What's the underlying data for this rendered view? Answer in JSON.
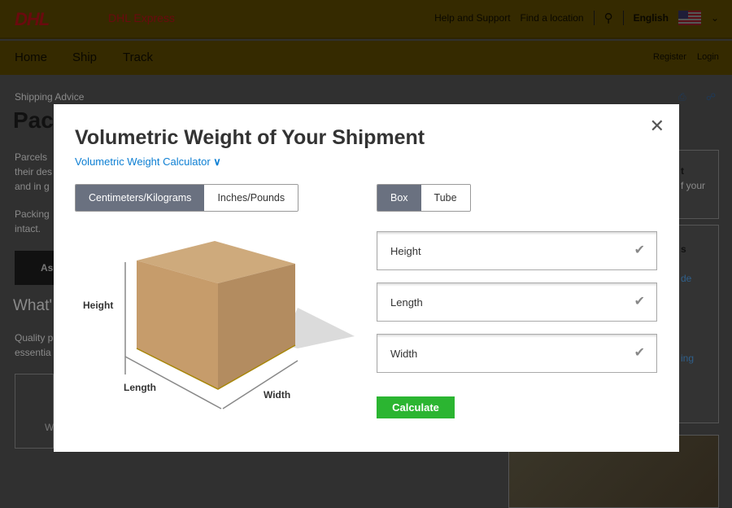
{
  "header": {
    "logo": "DHL",
    "brand": "DHL Express",
    "links": [
      "Help and Support",
      "Find a location"
    ],
    "language": "English"
  },
  "nav": {
    "items": [
      "Home",
      "Ship",
      "Track"
    ],
    "register": "Register",
    "login": "Login"
  },
  "background": {
    "breadcrumb": "Shipping Advice",
    "heading": "Pac",
    "p1": [
      "Parcels",
      "their des",
      "and in g"
    ],
    "p2": [
      "Packing",
      "intact."
    ],
    "button": "As",
    "heading2": "What'",
    "p3": [
      "Quality p",
      "essentia"
    ],
    "card_text": "W",
    "right": [
      "t",
      "f your",
      "s",
      "de",
      "ing"
    ]
  },
  "modal": {
    "title": "Volumetric Weight of Your Shipment",
    "subtitle": "Volumetric Weight Calculator",
    "units": [
      {
        "label": "Centimeters/Kilograms",
        "selected": true
      },
      {
        "label": "Inches/Pounds",
        "selected": false
      }
    ],
    "shapes": [
      {
        "label": "Box",
        "selected": true
      },
      {
        "label": "Tube",
        "selected": false
      }
    ],
    "diagram": {
      "height": "Height",
      "length": "Length",
      "width": "Width"
    },
    "fields": [
      {
        "placeholder": "Height"
      },
      {
        "placeholder": "Length"
      },
      {
        "placeholder": "Width"
      }
    ],
    "calculate": "Calculate"
  },
  "colors": {
    "brand_yellow": "#ffcc00",
    "brand_red": "#d40511",
    "accent_blue": "#0d7fd3",
    "calculate_green": "#2bb531",
    "selected_segment": "#6a7180"
  }
}
